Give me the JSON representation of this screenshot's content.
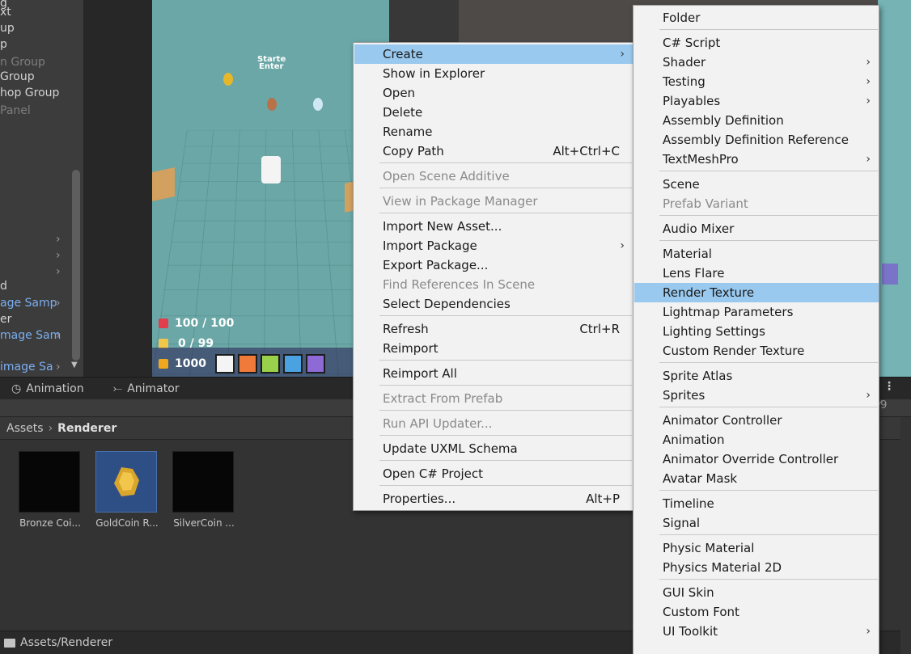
{
  "hierarchy": {
    "items": [
      {
        "text": "g",
        "state": "normal"
      },
      {
        "text": "xt",
        "state": "normal"
      },
      {
        "text": "up",
        "state": "normal"
      },
      {
        "text": "p",
        "state": "normal"
      },
      {
        "text": "n Group",
        "state": "dim"
      },
      {
        "text": "Group",
        "state": "normal"
      },
      {
        "text": "hop Group",
        "state": "normal"
      },
      {
        "text": "Panel",
        "state": "dim"
      },
      {
        "text": "d",
        "state": "normal"
      },
      {
        "text": "age Samp",
        "state": "blue"
      },
      {
        "text": "er",
        "state": "normal"
      },
      {
        "text": "mage Sam",
        "state": "blue"
      },
      {
        "text": "image Sa",
        "state": "blue"
      }
    ]
  },
  "game": {
    "start_label_1": "Starte",
    "start_label_2": "Enter",
    "hp": "100 / 100",
    "bag": "0 / 99",
    "gold": "1000"
  },
  "bottom_tabs": {
    "animation": "Animation",
    "animator": "Animator"
  },
  "project": {
    "breadcrumb_root": "Assets",
    "breadcrumb_current": "Renderer",
    "assets": [
      {
        "label": "Bronze Coi...",
        "selected": false
      },
      {
        "label": "GoldCoin R...",
        "selected": true
      },
      {
        "label": "SilverCoin ...",
        "selected": false
      }
    ],
    "status_path": "Assets/Renderer",
    "right_info": "9"
  },
  "context_menu": {
    "items": [
      {
        "label": "Create",
        "shortcut": "",
        "submenu": true,
        "disabled": false,
        "highlighted": true
      },
      {
        "label": "Show in Explorer",
        "shortcut": "",
        "submenu": false,
        "disabled": false
      },
      {
        "label": "Open",
        "shortcut": "",
        "submenu": false,
        "disabled": false
      },
      {
        "label": "Delete",
        "shortcut": "",
        "submenu": false,
        "disabled": false
      },
      {
        "label": "Rename",
        "shortcut": "",
        "submenu": false,
        "disabled": false
      },
      {
        "label": "Copy Path",
        "shortcut": "Alt+Ctrl+C",
        "submenu": false,
        "disabled": false
      },
      {
        "label": "Open Scene Additive",
        "shortcut": "",
        "submenu": false,
        "disabled": true
      },
      {
        "label": "View in Package Manager",
        "shortcut": "",
        "submenu": false,
        "disabled": true
      },
      {
        "label": "Import New Asset...",
        "shortcut": "",
        "submenu": false,
        "disabled": false
      },
      {
        "label": "Import Package",
        "shortcut": "",
        "submenu": true,
        "disabled": false
      },
      {
        "label": "Export Package...",
        "shortcut": "",
        "submenu": false,
        "disabled": false
      },
      {
        "label": "Find References In Scene",
        "shortcut": "",
        "submenu": false,
        "disabled": true
      },
      {
        "label": "Select Dependencies",
        "shortcut": "",
        "submenu": false,
        "disabled": false
      },
      {
        "label": "Refresh",
        "shortcut": "Ctrl+R",
        "submenu": false,
        "disabled": false
      },
      {
        "label": "Reimport",
        "shortcut": "",
        "submenu": false,
        "disabled": false
      },
      {
        "label": "Reimport All",
        "shortcut": "",
        "submenu": false,
        "disabled": false
      },
      {
        "label": "Extract From Prefab",
        "shortcut": "",
        "submenu": false,
        "disabled": true
      },
      {
        "label": "Run API Updater...",
        "shortcut": "",
        "submenu": false,
        "disabled": true
      },
      {
        "label": "Update UXML Schema",
        "shortcut": "",
        "submenu": false,
        "disabled": false
      },
      {
        "label": "Open C# Project",
        "shortcut": "",
        "submenu": false,
        "disabled": false
      },
      {
        "label": "Properties...",
        "shortcut": "Alt+P",
        "submenu": false,
        "disabled": false
      }
    ]
  },
  "create_submenu": {
    "items": [
      {
        "label": "Folder",
        "submenu": false,
        "disabled": false
      },
      {
        "label": "C# Script",
        "submenu": false,
        "disabled": false
      },
      {
        "label": "Shader",
        "submenu": true,
        "disabled": false
      },
      {
        "label": "Testing",
        "submenu": true,
        "disabled": false
      },
      {
        "label": "Playables",
        "submenu": true,
        "disabled": false
      },
      {
        "label": "Assembly Definition",
        "submenu": false,
        "disabled": false
      },
      {
        "label": "Assembly Definition Reference",
        "submenu": false,
        "disabled": false
      },
      {
        "label": "TextMeshPro",
        "submenu": true,
        "disabled": false
      },
      {
        "label": "Scene",
        "submenu": false,
        "disabled": false
      },
      {
        "label": "Prefab Variant",
        "submenu": false,
        "disabled": true
      },
      {
        "label": "Audio Mixer",
        "submenu": false,
        "disabled": false
      },
      {
        "label": "Material",
        "submenu": false,
        "disabled": false
      },
      {
        "label": "Lens Flare",
        "submenu": false,
        "disabled": false
      },
      {
        "label": "Render Texture",
        "submenu": false,
        "disabled": false,
        "highlighted": true
      },
      {
        "label": "Lightmap Parameters",
        "submenu": false,
        "disabled": false
      },
      {
        "label": "Lighting Settings",
        "submenu": false,
        "disabled": false
      },
      {
        "label": "Custom Render Texture",
        "submenu": false,
        "disabled": false
      },
      {
        "label": "Sprite Atlas",
        "submenu": false,
        "disabled": false
      },
      {
        "label": "Sprites",
        "submenu": true,
        "disabled": false
      },
      {
        "label": "Animator Controller",
        "submenu": false,
        "disabled": false
      },
      {
        "label": "Animation",
        "submenu": false,
        "disabled": false
      },
      {
        "label": "Animator Override Controller",
        "submenu": false,
        "disabled": false
      },
      {
        "label": "Avatar Mask",
        "submenu": false,
        "disabled": false
      },
      {
        "label": "Timeline",
        "submenu": false,
        "disabled": false
      },
      {
        "label": "Signal",
        "submenu": false,
        "disabled": false
      },
      {
        "label": "Physic Material",
        "submenu": false,
        "disabled": false
      },
      {
        "label": "Physics Material 2D",
        "submenu": false,
        "disabled": false
      },
      {
        "label": "GUI Skin",
        "submenu": false,
        "disabled": false
      },
      {
        "label": "Custom Font",
        "submenu": false,
        "disabled": false
      },
      {
        "label": "UI Toolkit",
        "submenu": true,
        "disabled": false
      }
    ]
  },
  "icons": {
    "submenu_arrow": "chevron-right-icon",
    "hp_icon": "heart-icon",
    "bag_icon": "bag-icon",
    "gold_icon": "coin-icon",
    "folder_icon": "folder-icon",
    "animation_tab_icon": "animation-clock-icon",
    "animator_tab_icon": "animator-graph-icon"
  },
  "colors": {
    "menu_highlight": "#99c9ef",
    "selection_blue": "#2d4f86",
    "game_floor": "#6aa7a6"
  }
}
